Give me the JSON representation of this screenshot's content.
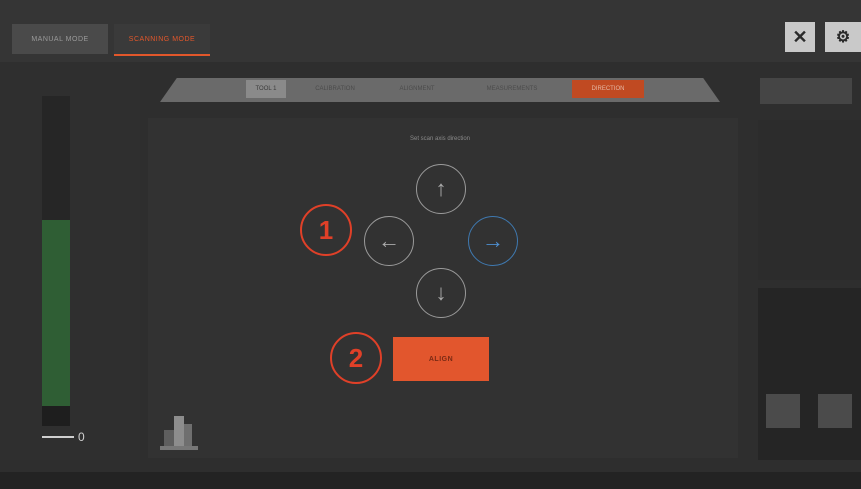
{
  "header": {
    "tab_left": "MANUAL MODE",
    "tab_active": "SCANNING MODE",
    "center_title": "",
    "close_icon": "close-icon",
    "settings_icon": "gear-icon"
  },
  "left": {
    "level_value": "0",
    "caption": ""
  },
  "subtabs": [
    {
      "label": "TOOL 1"
    },
    {
      "label": "CALIBRATION"
    },
    {
      "label": "ALIGNMENT"
    },
    {
      "label": "MEASUREMENTS"
    },
    {
      "label": "DIRECTION"
    }
  ],
  "right": {
    "top_button": "",
    "small_btn_1": "",
    "small_btn_2": ""
  },
  "main": {
    "instruction": "Set scan axis direction",
    "arrows": {
      "up": "↑",
      "left": "←",
      "right": "→",
      "down": "↓"
    },
    "callout_1": "1",
    "callout_2": "2",
    "align_label": "ALIGN"
  },
  "status": {
    "item1": "",
    "item2_label": "",
    "item2_value": "",
    "item3_label": "",
    "item3_value": "",
    "item4_label": "",
    "item4_value": "",
    "item5_label": "",
    "item5_value": ""
  },
  "colors": {
    "accent": "#e2562d",
    "blue_arrow": "#4e8fd0",
    "callout": "#e04028",
    "level_green": "#2f5e34"
  }
}
